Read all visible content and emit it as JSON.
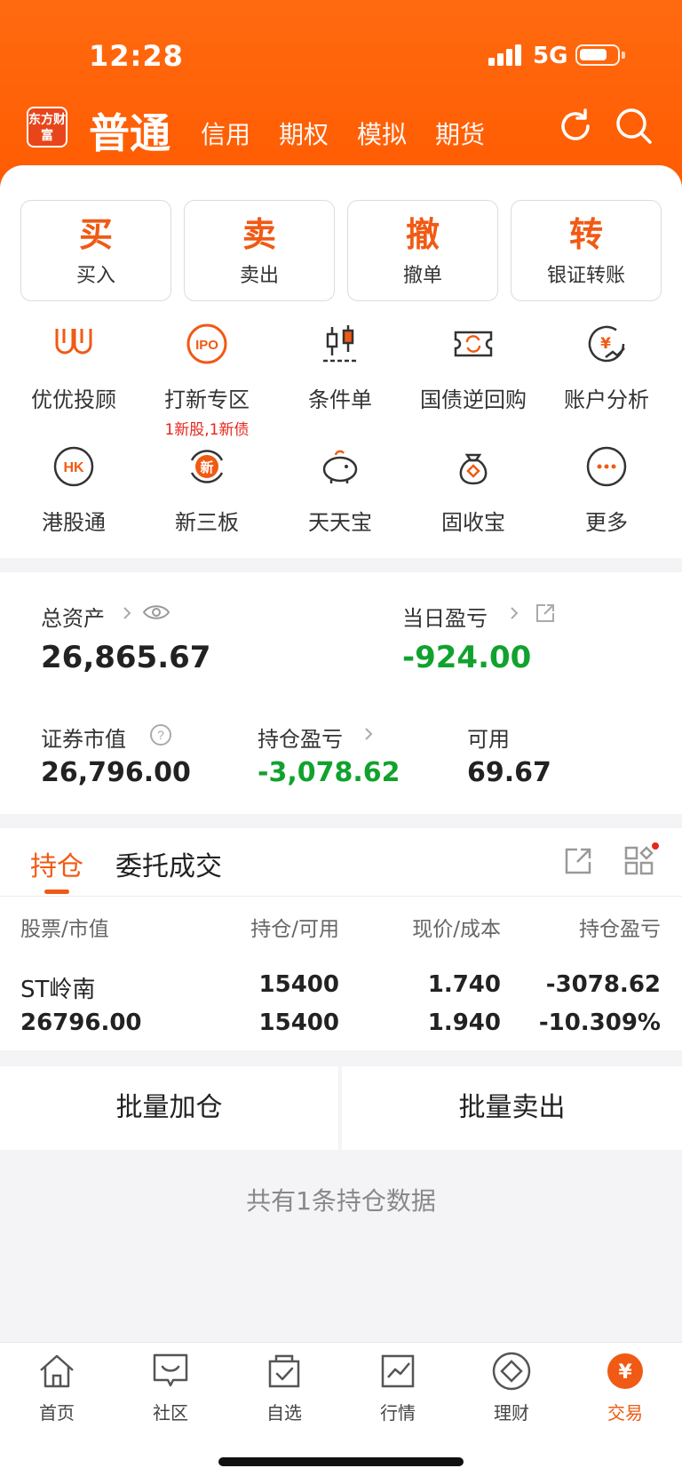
{
  "status": {
    "time": "12:28",
    "network": "5G"
  },
  "header": {
    "logo": "东方财富",
    "active_account": "普通",
    "account_tabs": [
      "信用",
      "期权",
      "模拟",
      "期货"
    ]
  },
  "quick_actions": [
    {
      "icon_char": "买",
      "label": "买入"
    },
    {
      "icon_char": "卖",
      "label": "卖出"
    },
    {
      "icon_char": "撤",
      "label": "撤单"
    },
    {
      "icon_char": "转",
      "label": "银证转账"
    }
  ],
  "services": [
    {
      "label": "优优投顾",
      "icon": "youyou-icon"
    },
    {
      "label": "打新专区",
      "sub": "1新股,1新债",
      "icon": "ipo-icon"
    },
    {
      "label": "条件单",
      "icon": "candlestick-icon"
    },
    {
      "label": "国债逆回购",
      "icon": "repo-icon"
    },
    {
      "label": "账户分析",
      "icon": "yen-chart-icon"
    },
    {
      "label": "港股通",
      "icon": "hk-icon"
    },
    {
      "label": "新三板",
      "icon": "new-board-icon"
    },
    {
      "label": "天天宝",
      "icon": "piggy-bank-icon"
    },
    {
      "label": "固收宝",
      "icon": "money-bag-icon"
    },
    {
      "label": "更多",
      "icon": "more-icon"
    }
  ],
  "assets": {
    "total_label": "总资产",
    "total_value": "26,865.67",
    "daily_pl_label": "当日盈亏",
    "daily_pl_value": "-924.00",
    "market_value_label": "证券市值",
    "market_value": "26,796.00",
    "position_pl_label": "持仓盈亏",
    "position_pl_value": "-3,078.62",
    "available_label": "可用",
    "available_value": "69.67"
  },
  "holdings": {
    "tabs": [
      "持仓",
      "委托成交"
    ],
    "columns": [
      "股票/市值",
      "持仓/可用",
      "现价/成本",
      "持仓盈亏"
    ],
    "rows": [
      {
        "name": "ST岭南",
        "market_value": "26796.00",
        "position": "15400",
        "available": "15400",
        "price": "1.740",
        "cost": "1.940",
        "pl": "-3078.62",
        "pl_pct": "-10.309%"
      }
    ]
  },
  "batch": {
    "add": "批量加仓",
    "sell": "批量卖出"
  },
  "summary": "共有1条持仓数据",
  "tabbar": [
    {
      "label": "首页",
      "icon": "home-icon"
    },
    {
      "label": "社区",
      "icon": "community-icon"
    },
    {
      "label": "自选",
      "icon": "watchlist-icon"
    },
    {
      "label": "行情",
      "icon": "market-icon"
    },
    {
      "label": "理财",
      "icon": "finance-icon"
    },
    {
      "label": "交易",
      "icon": "trade-icon",
      "active": true
    }
  ],
  "colors": {
    "accent": "#f05a14",
    "header": "#ff5a00",
    "loss": "#11a22e",
    "badge": "#e8261c"
  }
}
